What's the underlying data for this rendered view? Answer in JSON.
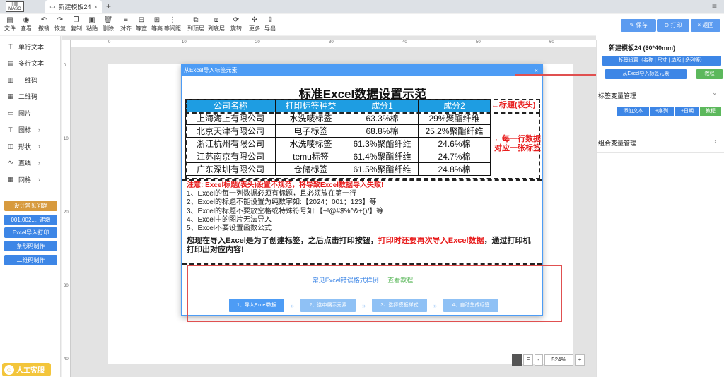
{
  "tabbar": {
    "logo_text": "|||||| MASO",
    "tab_title": "新建模板24",
    "tab_close": "×",
    "add_tab": "+",
    "menu": "≡"
  },
  "toolbar": {
    "items": [
      {
        "label": "文件",
        "icon": "file-icon",
        "glyph": "▤"
      },
      {
        "label": "查看",
        "icon": "eye-icon",
        "glyph": "◉"
      },
      {
        "label": "撤销",
        "icon": "undo-icon",
        "glyph": "↶"
      },
      {
        "label": "恢复",
        "icon": "redo-icon",
        "glyph": "↷"
      },
      {
        "label": "复制",
        "icon": "copy-icon",
        "glyph": "❐"
      },
      {
        "label": "粘贴",
        "icon": "paste-icon",
        "glyph": "▣"
      },
      {
        "label": "删除",
        "icon": "trash-icon",
        "glyph": "🗑"
      },
      {
        "label": "对齐",
        "icon": "align-icon",
        "glyph": "≡"
      },
      {
        "label": "等宽",
        "icon": "equal-width-icon",
        "glyph": "⊟"
      },
      {
        "label": "等高",
        "icon": "equal-height-icon",
        "glyph": "⊞"
      },
      {
        "label": "等间距",
        "icon": "equal-spacing-icon",
        "glyph": "⋮"
      },
      {
        "label": "到顶层",
        "icon": "bring-front-icon",
        "glyph": "⧉"
      },
      {
        "label": "到底层",
        "icon": "send-back-icon",
        "glyph": "⧈"
      },
      {
        "label": "旋转",
        "icon": "rotate-icon",
        "glyph": "⟳"
      },
      {
        "label": "更多",
        "icon": "more-icon",
        "glyph": "✣"
      },
      {
        "label": "导出",
        "icon": "export-icon",
        "glyph": "⇪"
      }
    ]
  },
  "actions": {
    "save": "保存",
    "print": "打印",
    "back": "返回"
  },
  "sidebar": {
    "items": [
      {
        "label": "单行文本",
        "icon": "text-icon",
        "glyph": "T",
        "chev": ""
      },
      {
        "label": "多行文本",
        "icon": "multiline-text-icon",
        "glyph": "▤",
        "chev": ""
      },
      {
        "label": "一维码",
        "icon": "barcode-icon",
        "glyph": "▥",
        "chev": ""
      },
      {
        "label": "二维码",
        "icon": "qrcode-icon",
        "glyph": "▦",
        "chev": ""
      },
      {
        "label": "图片",
        "icon": "image-icon",
        "glyph": "▭",
        "chev": ""
      },
      {
        "label": "图标",
        "icon": "icon-icon",
        "glyph": "T",
        "chev": "›"
      },
      {
        "label": "形状",
        "icon": "shape-icon",
        "glyph": "◫",
        "chev": "›"
      },
      {
        "label": "直线",
        "icon": "line-icon",
        "glyph": "∿",
        "chev": "›"
      },
      {
        "label": "网格",
        "icon": "grid-icon",
        "glyph": "▦",
        "chev": "›"
      }
    ],
    "buttons": [
      {
        "label": "设计常见问题",
        "color": "#d79a3e"
      },
      {
        "label": "001,002.... 递增",
        "color": "#3d86e6"
      },
      {
        "label": "Excel导入打印",
        "color": "#3d86e6"
      },
      {
        "label": "条形码制作",
        "color": "#3d86e6"
      },
      {
        "label": "二维码制作",
        "color": "#3d86e6"
      }
    ],
    "support": "人工客服"
  },
  "ruler": {
    "top": [
      "0",
      "10",
      "20",
      "30",
      "40",
      "50",
      "60"
    ],
    "left": [
      "0",
      "10",
      "20",
      "30",
      "40"
    ]
  },
  "zoom": {
    "f_label": "F",
    "minus": "-",
    "value": "524%",
    "plus": "+"
  },
  "modal": {
    "title": "从Excel导入标签元素",
    "close": "×",
    "demo_title": "标准Excel数据设置示范",
    "table_headers": [
      "公司名称",
      "打印标签种类",
      "成分1",
      "成分2"
    ],
    "table_rows": [
      [
        "上海海上有限公司",
        "水洗唛标签",
        "63.3%棉",
        "29%聚酯纤维"
      ],
      [
        "北京天津有限公司",
        "电子标签",
        "68.8%棉",
        "25.2%聚酯纤维"
      ],
      [
        "浙江杭州有限公司",
        "水洗唛标签",
        "61.3%聚酯纤维",
        "24.6%棉"
      ],
      [
        "江苏南京有限公司",
        "temu标签",
        "61.4%聚酯纤维",
        "24.7%棉"
      ],
      [
        "广东深圳有限公司",
        "仓储标签",
        "61.5%聚酯纤维",
        "24.8%棉"
      ]
    ],
    "annotation_header": "←标题(表头)",
    "annotation_rows_1": "←每一行数据",
    "annotation_rows_2": "对应一张标签",
    "warning": "注意: Excel标题(表头)设置不规范，将导致Excel数据导入失败!",
    "rules": [
      "1、Excel的每一列数据必须有标题，且必须放在第一行",
      "2、Excel的标题不能设置为纯数字如:【2024；001；123】等",
      "3、Excel的标题不要放空格或特殊符号如:【~!@#$%^&+()/】等",
      "4、Excel中的图片无法导入",
      "5、Excel不要设置函数公式"
    ],
    "bottom_note_a": "您现在导入Excel是为了创建标签，之后点击打印按钮，",
    "bottom_note_red": "打印时还要再次导入Excel数据",
    "bottom_note_b": "，通过打印机打印出对应内容!",
    "link_errors": "常见Excel错误格式样例",
    "link_tutorial": "查看教程",
    "steps": [
      "1、导入Excel数据",
      "2、选中展示元素",
      "3、选择模板样式",
      "4、自动生成标签"
    ],
    "step_arrow": "»"
  },
  "right_panel": {
    "template_title": "新建模板24 (60*40mm)",
    "settings_btn": "标签设置（名称 | 尺寸 | 边距 | 多列等）",
    "import_btn": "从Excel导入标签元素",
    "tutorial_btn": "教程",
    "var_section": "标签变量管理",
    "add_text": "添加文本",
    "add_seq": "+序列",
    "add_date": "+日期",
    "var_tutorial": "教程",
    "combo_section": "组合变量管理",
    "chev_down": "⌄",
    "chev_right": "›"
  },
  "colors": {
    "accent": "#4d9cf5",
    "header_blue": "#1e9de2",
    "warning_red": "#e81e1e",
    "green": "#5cb85c",
    "amber": "#f3c53b"
  }
}
